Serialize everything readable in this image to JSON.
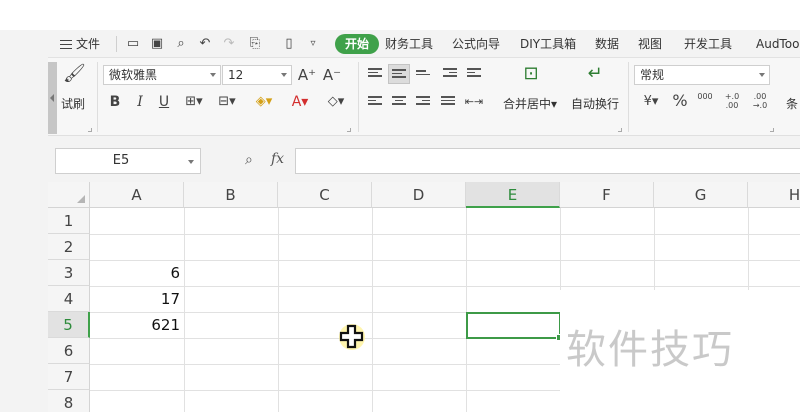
{
  "menu": {
    "file_label": "文件",
    "tabs": [
      {
        "label": "开始",
        "active": true
      },
      {
        "label": "财务工具"
      },
      {
        "label": "公式向导"
      },
      {
        "label": "DIY工具箱"
      },
      {
        "label": "数据"
      },
      {
        "label": "视图"
      },
      {
        "label": "开发工具"
      },
      {
        "label": "AudToo"
      }
    ],
    "accent_color": "#3fa14a"
  },
  "ribbon": {
    "format_painter_label": "试刷",
    "font_name": "微软雅黑",
    "font_size": "12",
    "grow_font": "A⁺",
    "shrink_font": "A⁻",
    "bold": "B",
    "italic": "I",
    "underline": "U",
    "font_color_glyph": "A",
    "merge_center_label": "合并居中",
    "wrap_text_label": "自动换行",
    "number_format": "常规",
    "percent": "%",
    "thousands": "000",
    "inc_decimal": "+.0 .00",
    "dec_decimal": ".00 →.0",
    "conditional_label": "条"
  },
  "formula_bar": {
    "name_box": "E5",
    "fx_label": "fx",
    "formula": ""
  },
  "sheet": {
    "columns": [
      "A",
      "B",
      "C",
      "D",
      "E",
      "F",
      "G",
      "H"
    ],
    "selected_column": "E",
    "rows": [
      "1",
      "2",
      "3",
      "4",
      "5",
      "6",
      "7",
      "8"
    ],
    "selected_row": "5",
    "cells": {
      "A3": "6",
      "A4": "17",
      "A5": "621"
    },
    "active_cell": "E5",
    "selection_color": "#3d9a47"
  },
  "watermark": "软件技巧"
}
